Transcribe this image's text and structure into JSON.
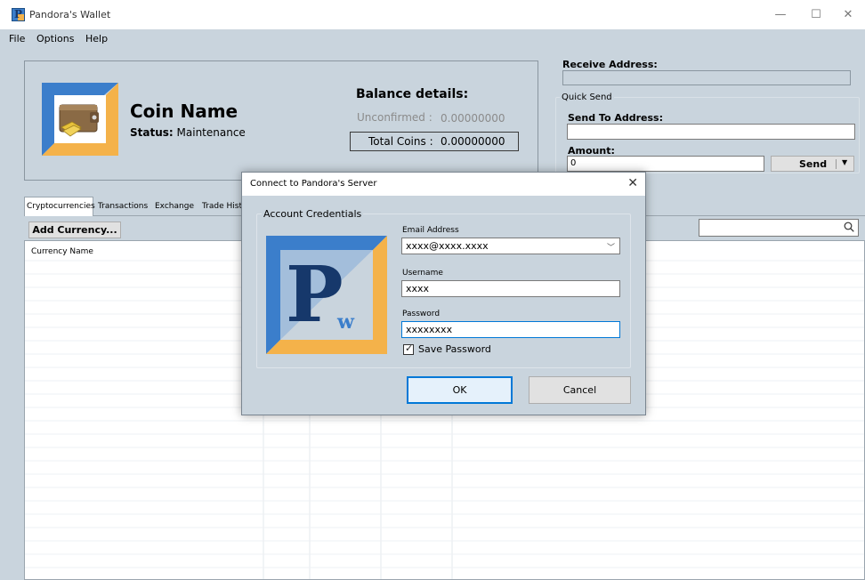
{
  "window": {
    "title": "Pandora's Wallet",
    "minimize": "—",
    "maximize": "☐",
    "close": "✕"
  },
  "menu": [
    "File",
    "Options",
    "Help"
  ],
  "header": {
    "coin_name": "Coin Name",
    "status_label": "Status:",
    "status_value": "Maintenance",
    "balance_title": "Balance details:",
    "unconfirmed_label": "Unconfirmed :",
    "unconfirmed_value": "0.00000000",
    "total_label": "Total Coins :",
    "total_value": "0.00000000"
  },
  "receive": {
    "label": "Receive Address:",
    "value": ""
  },
  "quick_send": {
    "legend": "Quick Send",
    "send_to_label": "Send To Address:",
    "send_to_value": "",
    "amount_label": "Amount:",
    "amount_value": "0",
    "send_label": "Send"
  },
  "tabs": [
    "Cryptocurrencies",
    "Transactions",
    "Exchange",
    "Trade Hist"
  ],
  "toolbar": {
    "add_currency": "Add Currency..."
  },
  "grid": {
    "columns": [
      "Currency Name"
    ]
  },
  "dialog": {
    "title": "Connect to Pandora's  Server",
    "close": "✕",
    "group_legend": "Account Credentials",
    "email_label": "Email Address",
    "email_value": "xxxx@xxxx.xxxx",
    "username_label": "Username",
    "username_value": "xxxx",
    "password_label": "Password",
    "password_value": "xxxxxxxx",
    "save_password_label": "Save Password",
    "save_password_checked": true,
    "ok_label": "OK",
    "cancel_label": "Cancel"
  },
  "colors": {
    "background": "#c9d4dd",
    "logo_blue": "#3b7ecb",
    "logo_orange": "#f4b24a",
    "focus_blue": "#0078d7"
  }
}
